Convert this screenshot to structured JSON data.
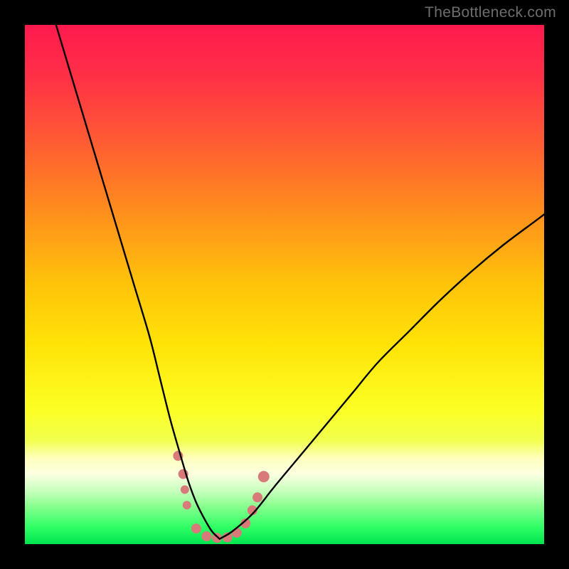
{
  "watermark": "TheBottleneck.com",
  "gradient": {
    "stops": [
      {
        "offset": 0.0,
        "color": "#ff1a4e"
      },
      {
        "offset": 0.1,
        "color": "#ff3046"
      },
      {
        "offset": 0.22,
        "color": "#ff5a34"
      },
      {
        "offset": 0.35,
        "color": "#ff8a1e"
      },
      {
        "offset": 0.5,
        "color": "#ffc40a"
      },
      {
        "offset": 0.62,
        "color": "#ffe408"
      },
      {
        "offset": 0.74,
        "color": "#fcff24"
      },
      {
        "offset": 0.8,
        "color": "#f1ff4d"
      },
      {
        "offset": 0.835,
        "color": "#ffffbe"
      },
      {
        "offset": 0.865,
        "color": "#fbffe0"
      },
      {
        "offset": 0.895,
        "color": "#ccffc1"
      },
      {
        "offset": 0.925,
        "color": "#8dff91"
      },
      {
        "offset": 0.965,
        "color": "#33ff66"
      },
      {
        "offset": 1.0,
        "color": "#00e64f"
      }
    ]
  },
  "chart_data": {
    "type": "line",
    "title": "",
    "xlabel": "",
    "ylabel": "",
    "xlim": [
      0,
      100
    ],
    "ylim": [
      0,
      100
    ],
    "series": [
      {
        "name": "left-curve",
        "x": [
          6,
          9,
          12,
          15,
          18,
          21,
          24,
          26,
          28,
          30,
          31.5,
          33,
          34.5,
          36,
          37.5
        ],
        "y": [
          100,
          90,
          80,
          70,
          60,
          50,
          40,
          32,
          24,
          17,
          12,
          8,
          5,
          2.5,
          1
        ]
      },
      {
        "name": "right-curve",
        "x": [
          37.5,
          40,
          44,
          48,
          53,
          58,
          63,
          68,
          74,
          80,
          86,
          92,
          98,
          100
        ],
        "y": [
          1,
          2.5,
          6,
          11,
          17,
          23,
          29,
          35,
          41,
          47,
          52.5,
          57.5,
          62,
          63.5
        ]
      }
    ],
    "markers": {
      "name": "valley-dots",
      "color": "#d97a7a",
      "points": [
        {
          "x": 29.5,
          "y": 17,
          "r": 7
        },
        {
          "x": 30.5,
          "y": 13.5,
          "r": 7
        },
        {
          "x": 30.8,
          "y": 10.5,
          "r": 6
        },
        {
          "x": 31.2,
          "y": 7.5,
          "r": 6
        },
        {
          "x": 33.0,
          "y": 3.0,
          "r": 7
        },
        {
          "x": 35.0,
          "y": 1.5,
          "r": 7
        },
        {
          "x": 37.0,
          "y": 1.2,
          "r": 7
        },
        {
          "x": 39.0,
          "y": 1.3,
          "r": 7
        },
        {
          "x": 40.8,
          "y": 2.2,
          "r": 7
        },
        {
          "x": 42.5,
          "y": 4.0,
          "r": 7
        },
        {
          "x": 43.8,
          "y": 6.5,
          "r": 7
        },
        {
          "x": 44.8,
          "y": 9.0,
          "r": 7
        },
        {
          "x": 46.0,
          "y": 13.0,
          "r": 8
        }
      ]
    }
  }
}
